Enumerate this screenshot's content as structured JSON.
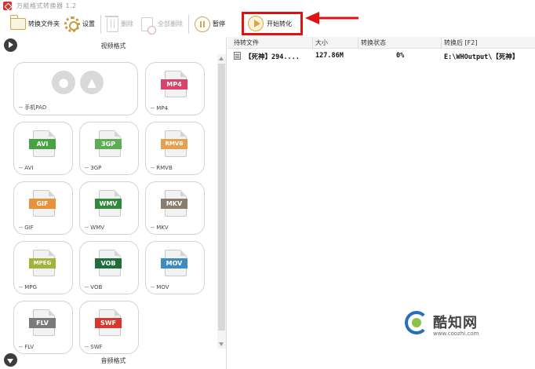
{
  "window": {
    "title": "万能格式转换器 1.2"
  },
  "toolbar": {
    "convert_folder": "转换文件夹",
    "settings": "设置",
    "delete": "删除",
    "delete_all": "全部删除",
    "pause": "暂停",
    "start": "开始转化"
  },
  "left": {
    "video_section": "视频格式",
    "audio_section": "音频格式",
    "tiles": [
      {
        "format": "",
        "caption": "-- 手机PAD",
        "color": ""
      },
      {
        "format": "MP4",
        "caption": "-- MP4",
        "color": "#d9436a"
      },
      {
        "format": "AVI",
        "caption": "-- AVI",
        "color": "#47a23f"
      },
      {
        "format": "3GP",
        "caption": "-- 3GP",
        "color": "#5bae54"
      },
      {
        "format": "RMVB",
        "caption": "-- RMVB",
        "color": "#e6a04e"
      },
      {
        "format": "GIF",
        "caption": "-- GIF",
        "color": "#e8903a"
      },
      {
        "format": "WMV",
        "caption": "-- WMV",
        "color": "#2e8b3a"
      },
      {
        "format": "MKV",
        "caption": "-- MKV",
        "color": "#8a7c6e"
      },
      {
        "format": "MPEG",
        "caption": "-- MPG",
        "color": "#9cb53a"
      },
      {
        "format": "VOB",
        "caption": "-- VOB",
        "color": "#1f6e3a"
      },
      {
        "format": "MOV",
        "caption": "-- MOV",
        "color": "#3d8bc0"
      },
      {
        "format": "FLV",
        "caption": "-- FLV",
        "color": "#7a7a7a"
      },
      {
        "format": "SWF",
        "caption": "-- SWF",
        "color": "#d9362e"
      }
    ]
  },
  "filelist": {
    "columns": [
      "待转文件",
      "大小",
      "转换状态",
      "转换后 [F2]"
    ],
    "rows": [
      {
        "name": "【死神】294....",
        "size": "127.86M",
        "status": "0%",
        "output": "E:\\WHOutput\\【死神】"
      }
    ]
  },
  "watermark": {
    "title": "酷知网",
    "url": "www.coozhi.com"
  },
  "colors": {
    "highlight": "#e01111",
    "accent": "#d4a74a"
  }
}
